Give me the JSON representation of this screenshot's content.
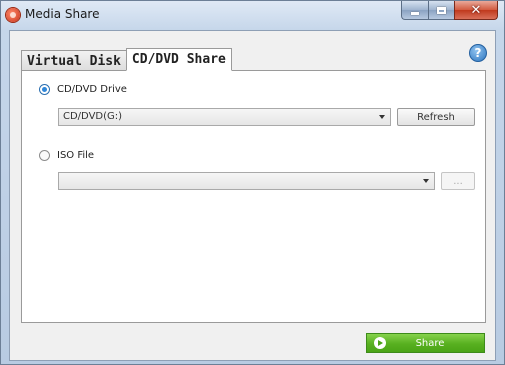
{
  "window": {
    "title": "Media Share",
    "colors": {
      "accent_green": "#58b020",
      "radio_blue": "#2f86d8",
      "close_red": "#c0391d"
    }
  },
  "caption_buttons": {
    "minimize_icon": "minimize-icon",
    "maximize_icon": "maximize-icon",
    "close_icon": "close-icon",
    "close_glyph": "✕"
  },
  "tabs": [
    {
      "label": "Virtual Disk",
      "active": false
    },
    {
      "label": "CD/DVD Share",
      "active": true
    }
  ],
  "help": {
    "glyph": "?"
  },
  "cd_dvd": {
    "radio_label": "CD/DVD Drive",
    "selected": true,
    "drive_value": "CD/DVD(G:)",
    "refresh_label": "Refresh"
  },
  "iso": {
    "radio_label": "ISO File",
    "selected": false,
    "file_value": "",
    "browse_label": "..."
  },
  "footer": {
    "share_label": "Share"
  }
}
